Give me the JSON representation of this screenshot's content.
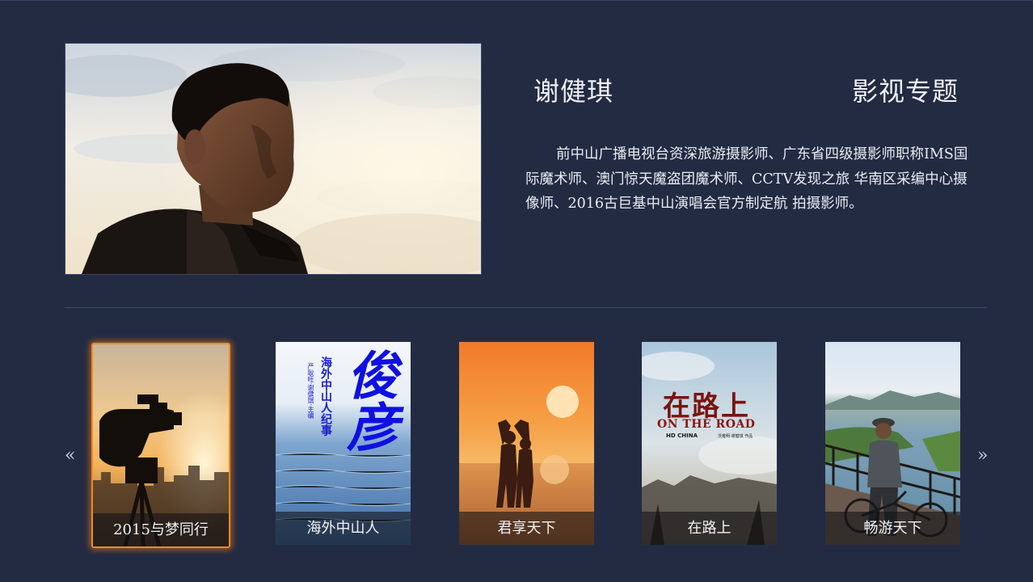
{
  "header": {
    "name": "谢健琪",
    "section": "影视专题"
  },
  "bio": "前中山广播电视台资深旅游摄影师、广东省四级摄影师职称IMS国际魔术师、澳门惊天魔盗团魔术师、CCTV发现之旅 华南区采编中心摄像师、2016古巨基中山演唱会官方制定航 拍摄影师。",
  "carousel": {
    "prev_icon": "double-chevron-left-icon",
    "next_icon": "double-chevron-right-icon",
    "prev_glyph": "«",
    "next_glyph": "»",
    "active_index": 0,
    "items": [
      {
        "caption": "2015与梦同行"
      },
      {
        "caption": "海外中山人",
        "poster_title": "俊彦",
        "poster_subtitle": "海外中山人纪事",
        "poster_credit": "严耿旺·谢健琪·主编"
      },
      {
        "caption": "君享天下"
      },
      {
        "caption": "在路上",
        "poster_title": "在路上",
        "poster_subtitle": "ON THE ROAD",
        "poster_logo": "HD CHINA",
        "poster_credit": "沃雍明·谢健琪 作品"
      },
      {
        "caption": "畅游天下"
      }
    ]
  },
  "colors": {
    "background": "#232b42",
    "active_border": "#f08a22",
    "text": "#e6e9f0"
  }
}
